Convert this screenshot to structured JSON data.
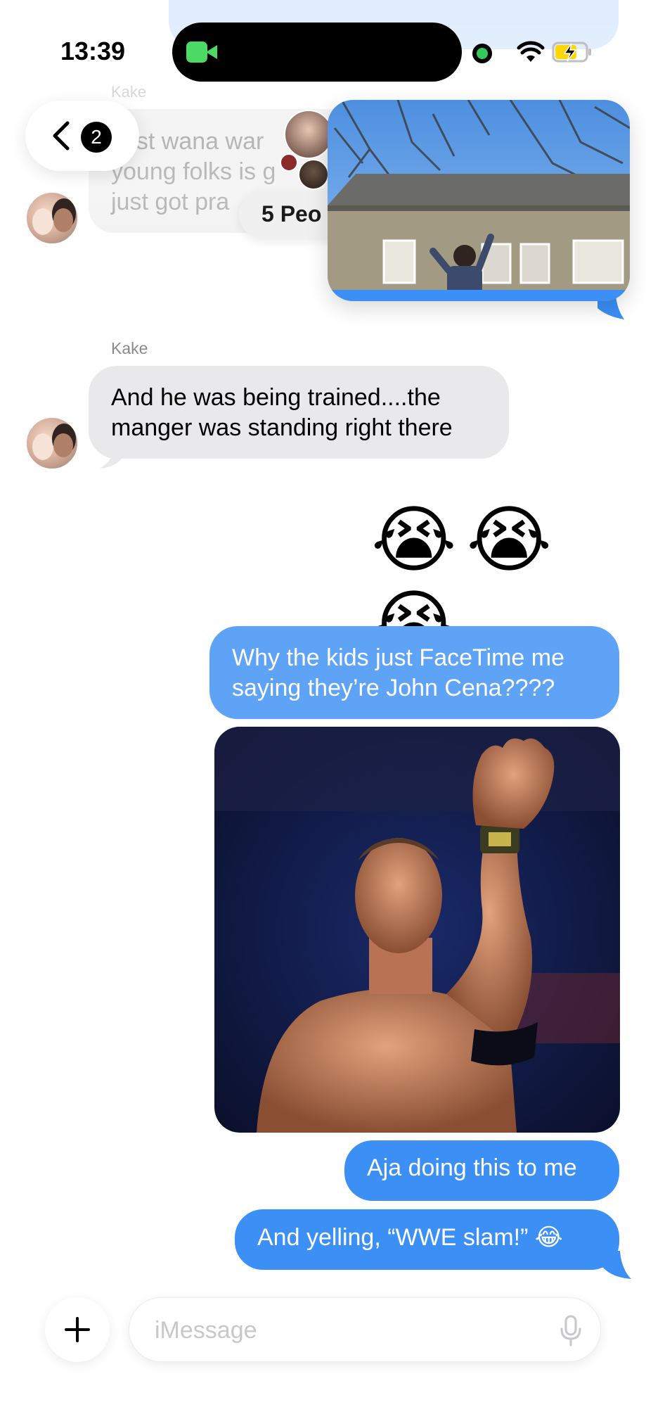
{
  "status_bar": {
    "time": "13:39"
  },
  "nav": {
    "back_badge": "2",
    "group_label": "5 Peo"
  },
  "colors": {
    "imessage_blue": "#3b8ff5",
    "received_gray": "#e9e9eb",
    "facetime_green": "#4cd964"
  },
  "icons": [
    "video-camera-icon",
    "wifi-icon",
    "battery-charging-icon",
    "chevron-left-icon",
    "plus-icon",
    "microphone-icon"
  ],
  "faded_message": {
    "sender": "Kake",
    "lines": [
      "Just wana war",
      "young folks is g",
      "just got pra"
    ]
  },
  "messages": {
    "kake_name": "Kake",
    "kake_text": "And he was being trained....the\nmanger was standing right there",
    "emoji_reaction": "😭😭😭",
    "sent_1": "Why the kids just FaceTime me\nsaying they’re John Cena????",
    "sent_2": "Aja doing this to me",
    "sent_3": "And yelling, “WWE slam!” 😂"
  },
  "composer": {
    "placeholder": "iMessage"
  }
}
